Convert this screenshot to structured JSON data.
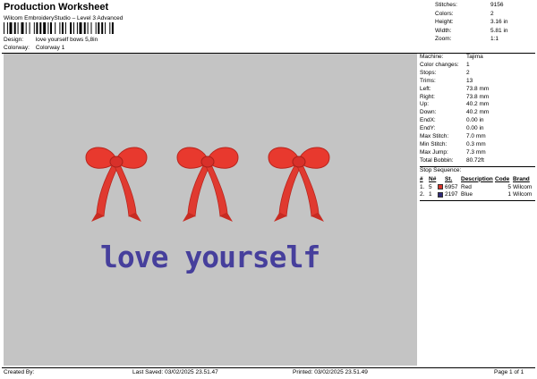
{
  "header": {
    "title": "Production Worksheet",
    "subtitle": "Wilcom EmbroideryStudio – Level 3 Advanced",
    "design_label": "Design:",
    "design_value": "love yourself bows 5,8in",
    "colorway_label": "Colorway:",
    "colorway_value": "Colorway 1"
  },
  "top_stats": [
    {
      "label": "Stitches:",
      "value": "9156"
    },
    {
      "label": "Colors:",
      "value": "2"
    },
    {
      "label": "Height:",
      "value": "3.16 in"
    },
    {
      "label": "Width:",
      "value": "5.81 in"
    },
    {
      "label": "Zoom:",
      "value": "1:1"
    }
  ],
  "machine_stats": [
    {
      "label": "Machine:",
      "value": "Tajima"
    },
    {
      "label": "Color changes:",
      "value": "1"
    },
    {
      "label": "Stops:",
      "value": "2"
    },
    {
      "label": "Trims:",
      "value": "13"
    },
    {
      "label": "Left:",
      "value": "73.8 mm"
    },
    {
      "label": "Right:",
      "value": "73.8 mm"
    },
    {
      "label": "Up:",
      "value": "40.2 mm"
    },
    {
      "label": "Down:",
      "value": "40.2 mm"
    },
    {
      "label": "EndX:",
      "value": "0.00 in"
    },
    {
      "label": "EndY:",
      "value": "0.00 in"
    },
    {
      "label": "Max Stitch:",
      "value": "7.0 mm"
    },
    {
      "label": "Min Stitch:",
      "value": "0.3 mm"
    },
    {
      "label": "Max Jump:",
      "value": "7.3 mm"
    },
    {
      "label": "Total Bobbin:",
      "value": "80.72ft"
    }
  ],
  "stop_sequence": {
    "title": "Stop Sequence:",
    "headers": {
      "num": "#",
      "n": "N#",
      "st": "St.",
      "desc": "Description",
      "code": "Code",
      "brand": "Brand"
    },
    "rows": [
      {
        "num": "1.",
        "n": "5",
        "color": "#d9342b",
        "st": "6957",
        "desc": "Red",
        "code": "5",
        "brand": "Wilcom"
      },
      {
        "num": "2.",
        "n": "1",
        "color": "#2f2a7a",
        "st": "2197",
        "desc": "Blue",
        "code": "1",
        "brand": "Wilcom"
      }
    ]
  },
  "design": {
    "text": "love yourself",
    "bow_color": "#e8392e",
    "text_color": "#463f9c"
  },
  "footer": {
    "created_by": "Created By:",
    "last_saved": "Last Saved: 03/02/2025 23.51.47",
    "printed": "Printed: 03/02/2025 23.51.49",
    "page": "Page 1 of 1"
  }
}
